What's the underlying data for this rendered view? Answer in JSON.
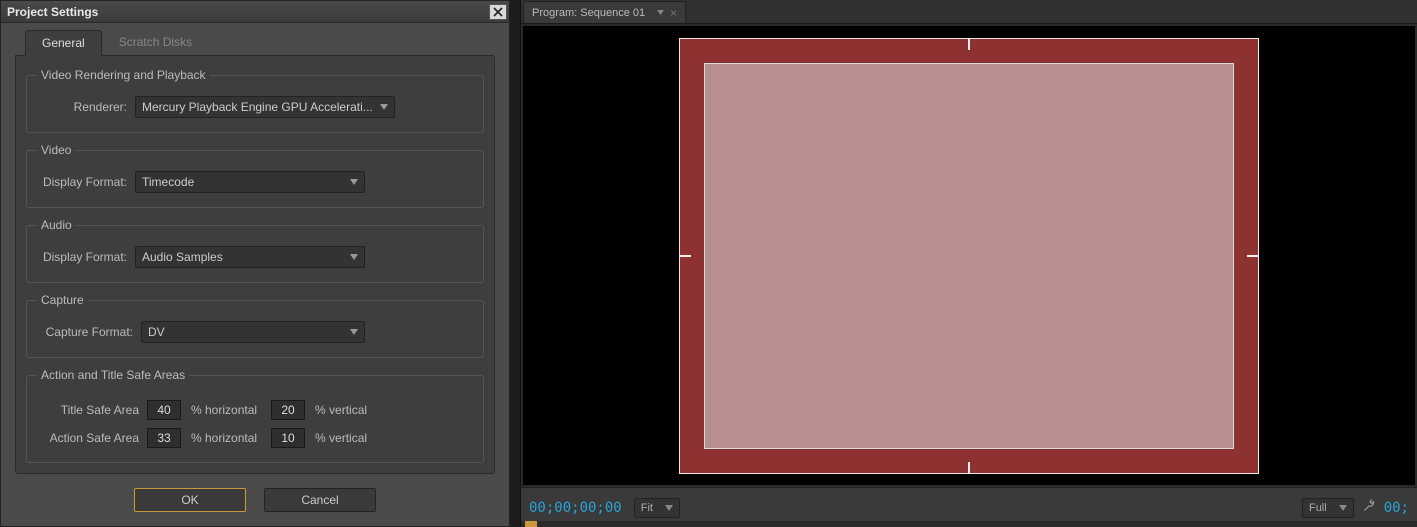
{
  "dialog": {
    "title": "Project Settings",
    "tabs": {
      "general": "General",
      "scratch": "Scratch Disks"
    },
    "sections": {
      "rendering": {
        "legend": "Video Rendering and Playback",
        "renderer_label": "Renderer:",
        "renderer_value": "Mercury Playback Engine GPU Accelerati..."
      },
      "video": {
        "legend": "Video",
        "format_label": "Display Format:",
        "format_value": "Timecode"
      },
      "audio": {
        "legend": "Audio",
        "format_label": "Display Format:",
        "format_value": "Audio Samples"
      },
      "capture": {
        "legend": "Capture",
        "format_label": "Capture Format:",
        "format_value": "DV"
      },
      "safe": {
        "legend": "Action and Title Safe Areas",
        "title_label": "Title Safe Area",
        "action_label": "Action Safe Area",
        "pct_h": "% horizontal",
        "pct_v": "% vertical",
        "title_h": "40",
        "title_v": "20",
        "action_h": "33",
        "action_v": "10"
      }
    },
    "buttons": {
      "ok": "OK",
      "cancel": "Cancel"
    }
  },
  "program": {
    "tab_label": "Program: Sequence 01",
    "timecode_left": "00;00;00;00",
    "timecode_right": "00;",
    "fit_label": "Fit",
    "full_label": "Full"
  }
}
